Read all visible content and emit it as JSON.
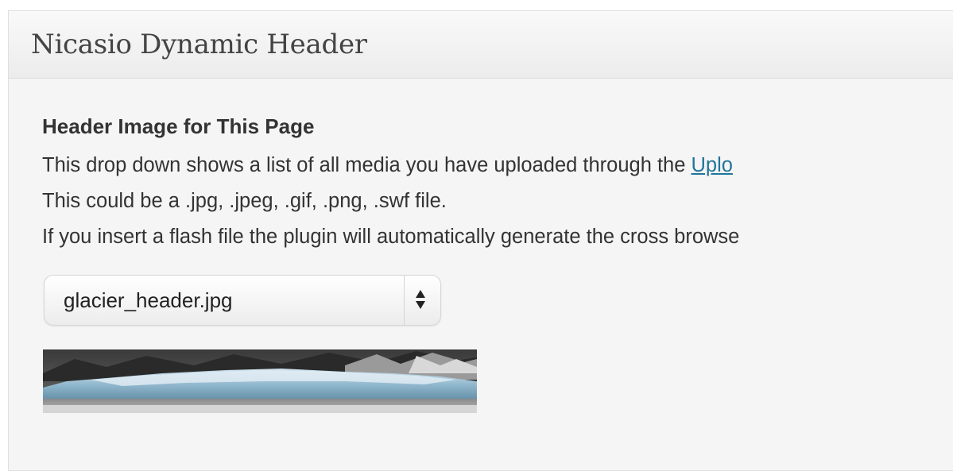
{
  "metabox": {
    "title": "Nicasio Dynamic Header"
  },
  "field": {
    "heading": "Header Image for This Page",
    "description": {
      "line1_text": "This drop down shows a list of all media you have uploaded through the ",
      "line1_link": "Uplo",
      "line2": "This could be a .jpg, .jpeg, .gif, .png, .swf file.",
      "line3": "If you insert a flash file the plugin will automatically generate the cross browse"
    }
  },
  "header_select": {
    "selected_value": "glacier_header.jpg",
    "icon": "updown-arrows-icon"
  },
  "preview": {
    "icon": "glacier-thumbnail-image"
  }
}
